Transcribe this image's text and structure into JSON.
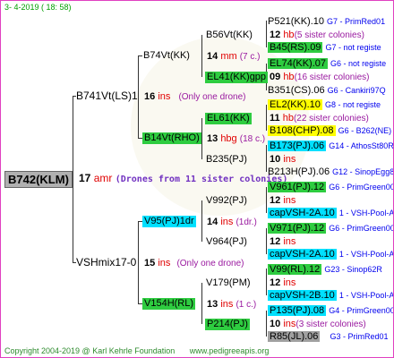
{
  "header": "3- 4-2019 ( 18: 58)",
  "footer": {
    "copyright": "Copyright 2004-2019 @ Karl Kehrle Foundation",
    "site": "www.pedigreeapis.org"
  },
  "root": {
    "label": "B742(KLM)",
    "num": "17",
    "unit": "amr",
    "note": "(Drones from 11 sister colonies)"
  },
  "nodes": {
    "sire": {
      "label": "B741Vt(LS)1",
      "num": "16",
      "unit": "ins",
      "note": "(Only one drone)"
    },
    "dam": {
      "label": "VSHmix17-0",
      "num": "15",
      "unit": "ins",
      "note": "(Only one drone)"
    },
    "ss": {
      "label": "B74Vt(KK)",
      "num": "14",
      "unit": "mm",
      "note": "(7 c.)"
    },
    "sd": {
      "label": "B14Vt(RHO)",
      "num": "13",
      "unit": "hbg",
      "note": "(18 c.)"
    },
    "ds": {
      "label": "V95(PJ)1dr",
      "num": "14",
      "unit": "ins",
      "note": "(1dr.)"
    },
    "dd": {
      "label": "V154H(RL)",
      "num": "13",
      "unit": "ins",
      "note": "(1 c.)"
    },
    "sss": {
      "label": "B56Vt(KK)"
    },
    "ssd": {
      "label": "EL41(KK)gpp"
    },
    "sds": {
      "label": "EL61(KK)"
    },
    "sdd": {
      "label": "B235(PJ)"
    },
    "dss": {
      "label": "V992(PJ)"
    },
    "dsd": {
      "label": "V964(PJ)"
    },
    "dds": {
      "label": "V179(PM)"
    },
    "ddd": {
      "label": "P214(PJ)"
    }
  },
  "leaves": [
    {
      "id": "P521(KK).10",
      "gen": "G7 - PrimRed01"
    },
    {
      "num": "12",
      "unit": "hb",
      "note": "(5 sister colonies)"
    },
    {
      "id": "B45(RS).09",
      "gen": "G7 - not registe"
    },
    {
      "id": "EL74(KK).07",
      "gen": "G6 - not registe"
    },
    {
      "num": "09",
      "unit": "hb",
      "note": "(16 sister colonies)"
    },
    {
      "id": "B351(CS).06",
      "gen": "G6 - Cankiri97Q"
    },
    {
      "id": "EL2(KK).10",
      "gen": "G8 - not registe"
    },
    {
      "num": "11",
      "unit": "hb",
      "note": "(22 sister colonies)"
    },
    {
      "id": "B108(CHP).08",
      "gen": "G6 - B262(NE)"
    },
    {
      "id": "B173(PJ).06",
      "gen": "G14 - AthosSt80R"
    },
    {
      "num": "10",
      "unit": "ins",
      "note": ""
    },
    {
      "id": "B213H(PJ).06",
      "gen": "G12 - SinopEgg86R"
    },
    {
      "id": "V961(PJ).12",
      "gen": "G6 - PrimGreen00"
    },
    {
      "num": "12",
      "unit": "ins",
      "note": ""
    },
    {
      "id": "capVSH-2A.10",
      "gen": "1 - VSH-Pool-AR"
    },
    {
      "id": "V971(PJ).12",
      "gen": "G6 - PrimGreen00"
    },
    {
      "num": "12",
      "unit": "ins",
      "note": ""
    },
    {
      "id": "capVSH-2A.10",
      "gen": "1 - VSH-Pool-AR"
    },
    {
      "id": "V99(RL).12",
      "gen": "G23 - Sinop62R"
    },
    {
      "num": "12",
      "unit": "ins",
      "note": ""
    },
    {
      "id": "capVSH-2B.10",
      "gen": "1 - VSH-Pool-AR"
    },
    {
      "id": "P135(PJ).08",
      "gen": "G4 - PrimGreen00"
    },
    {
      "num": "10",
      "unit": "ins",
      "note": "(3 sister colonies)"
    },
    {
      "id": "R85(JL).06",
      "gen": "G3 - PrimRed01"
    }
  ]
}
